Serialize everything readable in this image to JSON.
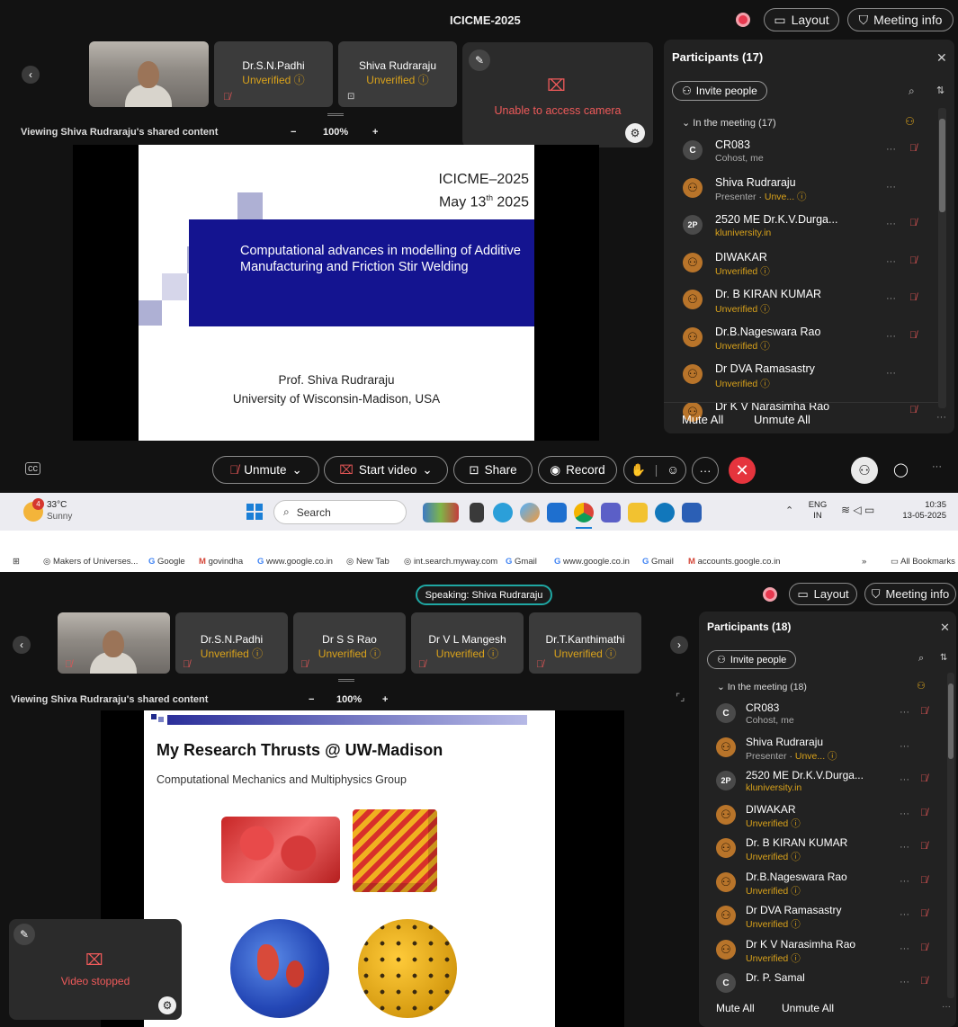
{
  "top": {
    "title": "ICICME-2025",
    "layout_label": "Layout",
    "meeting_info_label": "Meeting info",
    "tiles": [
      {
        "name": "Dr.S.N.Padhi",
        "status": "Unverified"
      },
      {
        "name": "Shiva Rudraraju",
        "status": "Unverified"
      }
    ],
    "camera_popup_text": "Unable to access camera",
    "viewing_label": "Viewing Shiva Rudraraju's shared content",
    "zoom": "100%",
    "zoom_minus": "−",
    "zoom_plus": "+",
    "slide": {
      "conf": "ICICME–2025",
      "date_main": "May 13",
      "date_sup": "th",
      "date_year": " 2025",
      "title": "Computational advances in modelling of Additive Manufacturing and Friction Stir Welding",
      "author": "Prof. Shiva Rudraraju",
      "affiliation": "University of Wisconsin-Madison, USA"
    },
    "panel": {
      "title": "Participants (17)",
      "invite_label": "Invite people",
      "section_label": "In the meeting (17)",
      "participants": [
        {
          "avatar": "C",
          "name": "CR083",
          "sub": "Cohost, me"
        },
        {
          "avatar": "",
          "name": "Shiva Rudraraju",
          "sub_role": "Presenter",
          "sub_status": "Unve..."
        },
        {
          "avatar": "2P",
          "name": "2520 ME Dr.K.V.Durga...",
          "sub": "kluniversity.in"
        },
        {
          "avatar": "",
          "name": "DIWAKAR",
          "sub": "Unverified"
        },
        {
          "avatar": "",
          "name": "Dr. B KIRAN KUMAR",
          "sub": "Unverified"
        },
        {
          "avatar": "",
          "name": "Dr.B.Nageswara Rao",
          "sub": "Unverified"
        },
        {
          "avatar": "",
          "name": "Dr DVA Ramasastry",
          "sub": "Unverified"
        },
        {
          "avatar": "",
          "name": "Dr K V Narasimha Rao",
          "sub": ""
        }
      ],
      "mute_all": "Mute All",
      "unmute_all": "Unmute All"
    },
    "controls": {
      "unmute": "Unmute",
      "start_video": "Start video",
      "share": "Share",
      "record": "Record"
    }
  },
  "taskbar": {
    "temp": "33°C",
    "weather": "Sunny",
    "weather_badge": "4",
    "search_placeholder": "Search",
    "lang": "ENG",
    "region": "IN",
    "time": "10:35",
    "date": "13-05-2025"
  },
  "bookmarks": {
    "items": [
      "Makers of Universes...",
      "Google",
      "govindha",
      "www.google.co.in",
      "New Tab",
      "int.search.myway.com",
      "Gmail",
      "www.google.co.in",
      "Gmail",
      "accounts.google.co.in"
    ],
    "overflow": "»",
    "all_label": "All Bookmarks"
  },
  "bottom": {
    "speaking": "Speaking: Shiva Rudraraju",
    "layout_label": "Layout",
    "meeting_info_label": "Meeting info",
    "tiles": [
      {
        "name": "Dr.S.N.Padhi",
        "status": "Unverified"
      },
      {
        "name": "Dr S S Rao",
        "status": "Unverified"
      },
      {
        "name": "Dr V L Mangesh",
        "status": "Unverified"
      },
      {
        "name": "Dr.T.Kanthimathi",
        "status": "Unverified"
      }
    ],
    "viewing_label": "Viewing Shiva Rudraraju's shared content",
    "zoom": "100%",
    "zoom_minus": "−",
    "zoom_plus": "+",
    "slide": {
      "title": "My Research Thrusts @ UW-Madison",
      "subtitle": "Computational Mechanics and Multiphysics Group"
    },
    "video_popup_text": "Video stopped",
    "panel": {
      "title": "Participants (18)",
      "invite_label": "Invite people",
      "section_label": "In the meeting (18)",
      "participants": [
        {
          "avatar": "C",
          "name": "CR083",
          "sub": "Cohost, me"
        },
        {
          "avatar": "",
          "name": "Shiva Rudraraju",
          "sub_role": "Presenter",
          "sub_status": "Unve..."
        },
        {
          "avatar": "2P",
          "name": "2520 ME Dr.K.V.Durga...",
          "sub": "kluniversity.in"
        },
        {
          "avatar": "",
          "name": "DIWAKAR",
          "sub": "Unverified"
        },
        {
          "avatar": "",
          "name": "Dr. B KIRAN KUMAR",
          "sub": "Unverified"
        },
        {
          "avatar": "",
          "name": "Dr.B.Nageswara Rao",
          "sub": "Unverified"
        },
        {
          "avatar": "",
          "name": "Dr DVA Ramasastry",
          "sub": "Unverified"
        },
        {
          "avatar": "",
          "name": "Dr K V Narasimha Rao",
          "sub": "Unverified"
        },
        {
          "avatar": "C",
          "name": "Dr. P. Samal",
          "sub": ""
        }
      ],
      "mute_all": "Mute All",
      "unmute_all": "Unmute All"
    }
  }
}
